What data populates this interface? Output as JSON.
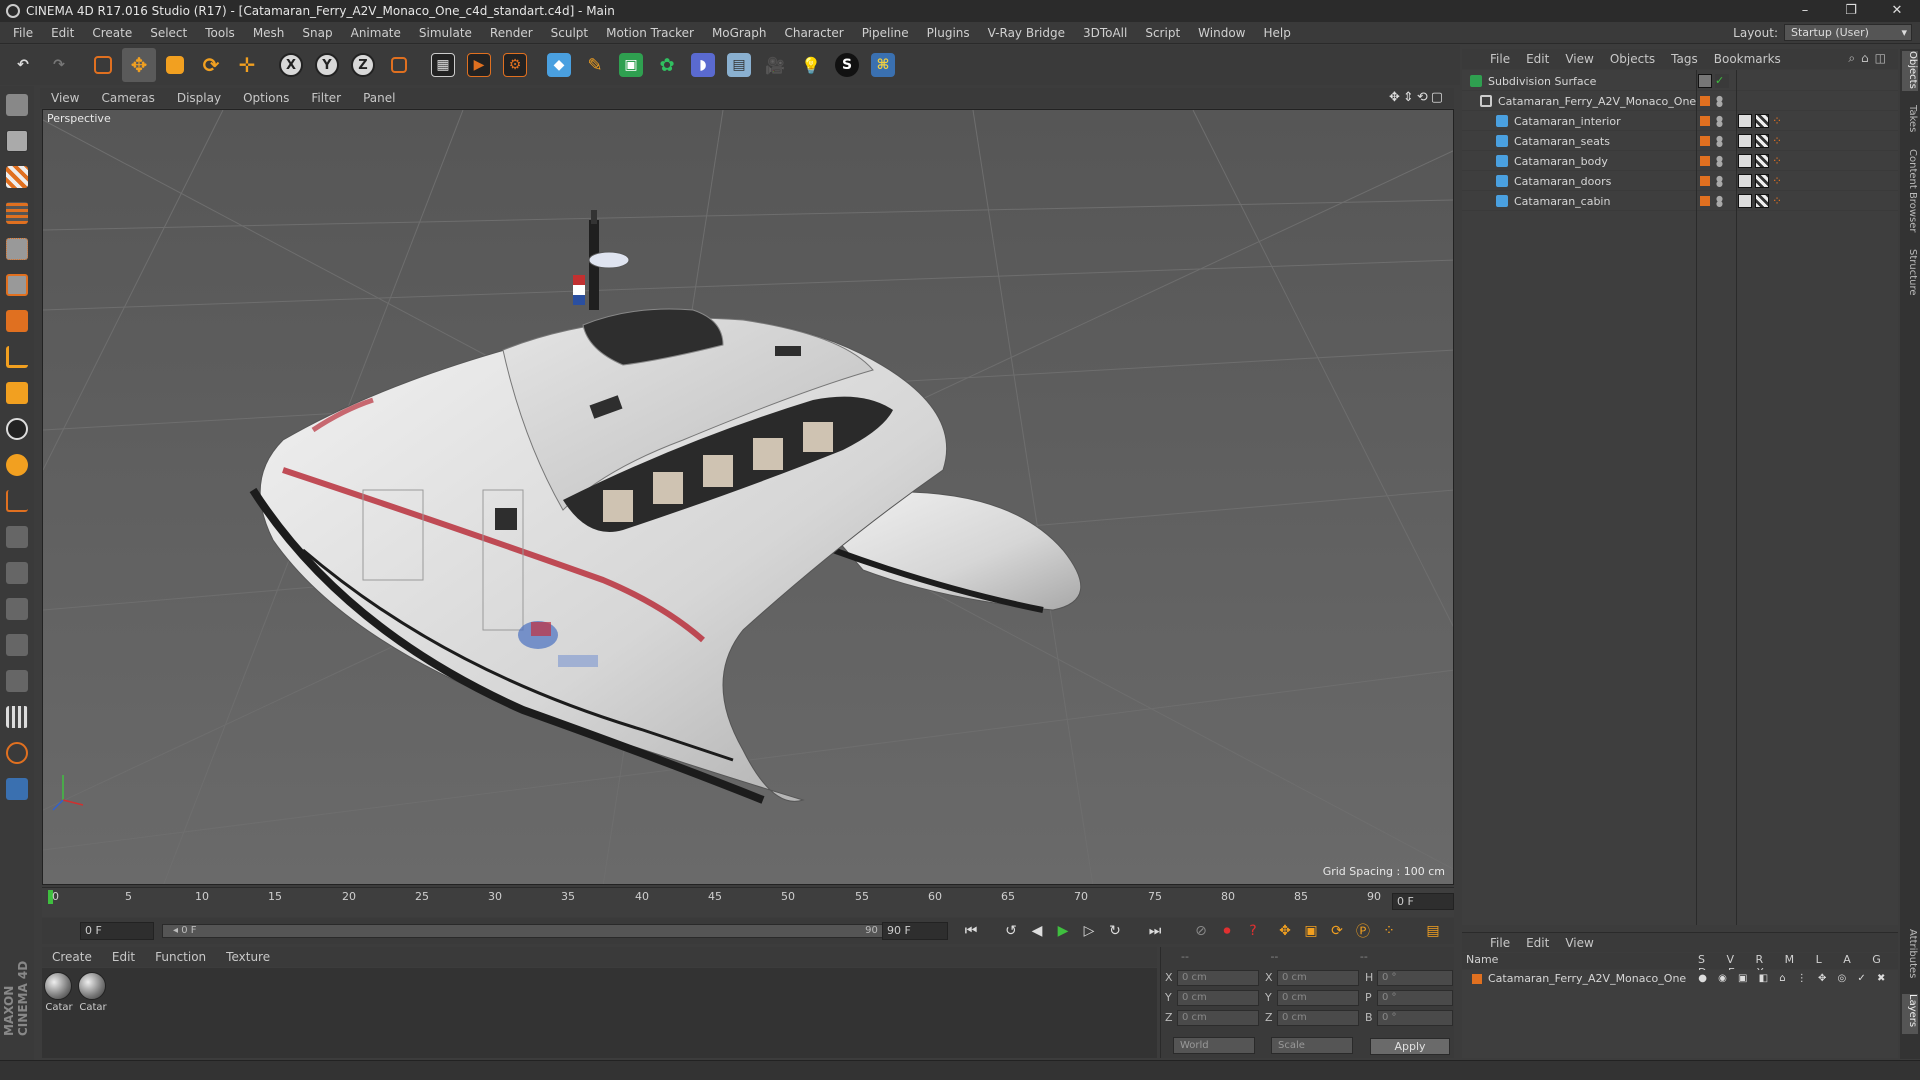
{
  "window": {
    "title": "CINEMA 4D R17.016 Studio (R17) - [Catamaran_Ferry_A2V_Monaco_One_c4d_standart.c4d] - Main",
    "controls": [
      "–",
      "❐",
      "✕"
    ]
  },
  "menubar": {
    "items": [
      "File",
      "Edit",
      "Create",
      "Select",
      "Tools",
      "Mesh",
      "Snap",
      "Animate",
      "Simulate",
      "Render",
      "Sculpt",
      "Motion Tracker",
      "MoGraph",
      "Character",
      "Pipeline",
      "Plugins",
      "V-Ray Bridge",
      "3DToAll",
      "Script",
      "Window",
      "Help"
    ],
    "layout_label": "Layout:",
    "layout_value": "Startup (User)"
  },
  "toolbar": {
    "axis_x": "X",
    "axis_y": "Y",
    "axis_z": "Z"
  },
  "viewport": {
    "menu": [
      "View",
      "Cameras",
      "Display",
      "Options",
      "Filter",
      "Panel"
    ],
    "label": "Perspective",
    "grid_spacing": "Grid Spacing : 100 cm"
  },
  "timeline": {
    "ticks": [
      "0",
      "5",
      "10",
      "15",
      "20",
      "25",
      "30",
      "35",
      "40",
      "45",
      "50",
      "55",
      "60",
      "65",
      "70",
      "75",
      "80",
      "85",
      "90"
    ],
    "current_frame": "0 F",
    "start_field": "0 F",
    "range_start": "◂ 0 F",
    "range_end": "90 F ▸",
    "end_field": "90 F"
  },
  "materials": {
    "menu": [
      "Create",
      "Edit",
      "Function",
      "Texture"
    ],
    "items": [
      "Catar",
      "Catar"
    ]
  },
  "coordinates": {
    "header": [
      "--",
      "--",
      "--"
    ],
    "rows": [
      {
        "a": "X",
        "av": "0 cm",
        "b": "X",
        "bv": "0 cm",
        "c": "H",
        "cv": "0 °"
      },
      {
        "a": "Y",
        "av": "0 cm",
        "b": "Y",
        "bv": "0 cm",
        "c": "P",
        "cv": "0 °"
      },
      {
        "a": "Z",
        "av": "0 cm",
        "b": "Z",
        "bv": "0 cm",
        "c": "B",
        "cv": "0 °"
      }
    ],
    "space": "World",
    "mode": "Scale",
    "apply": "Apply"
  },
  "object_manager": {
    "menu": [
      "File",
      "Edit",
      "View",
      "Objects",
      "Tags",
      "Bookmarks"
    ],
    "objects": [
      {
        "name": "Subdivision Surface",
        "depth": 0
      },
      {
        "name": "Catamaran_Ferry_A2V_Monaco_One",
        "depth": 1
      },
      {
        "name": "Catamaran_interior",
        "depth": 2
      },
      {
        "name": "Catamaran_seats",
        "depth": 2
      },
      {
        "name": "Catamaran_body",
        "depth": 2
      },
      {
        "name": "Catamaran_doors",
        "depth": 2
      },
      {
        "name": "Catamaran_cabin",
        "depth": 2
      }
    ]
  },
  "layer_manager": {
    "menu": [
      "File",
      "Edit",
      "View"
    ],
    "name_header": "Name",
    "columns": "S V R M L A G D E X",
    "layers": [
      "Catamaran_Ferry_A2V_Monaco_One"
    ]
  },
  "side_tabs": [
    "Objects",
    "Takes",
    "Content Browser",
    "Structure",
    "Attributes",
    "Layers"
  ],
  "branding": "MAXON CINEMA 4D",
  "colors": {
    "accent_orange": "#e07020",
    "playhead_green": "#3fbf3f",
    "viewport_bg": "#5d5d5d"
  }
}
